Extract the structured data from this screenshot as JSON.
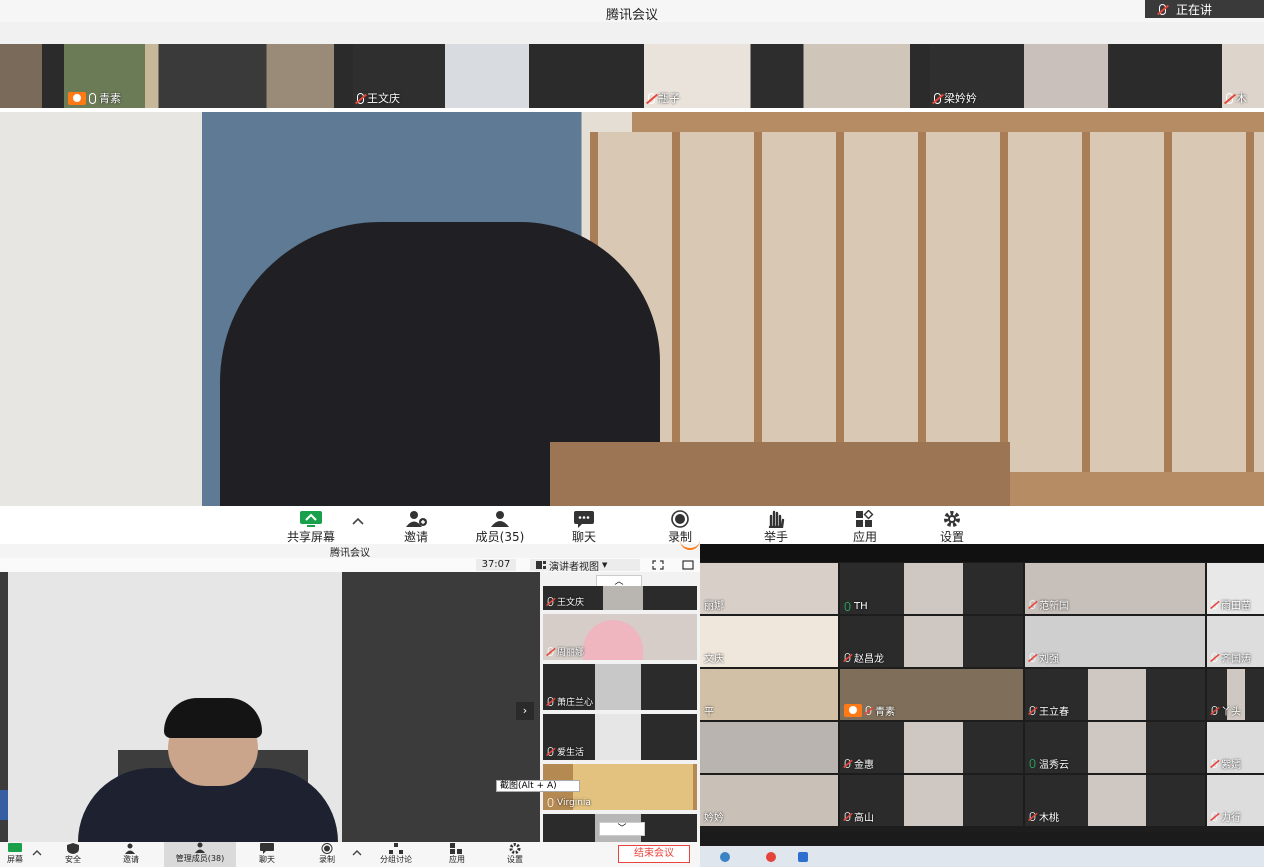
{
  "top": {
    "title": "腾讯会议",
    "speaking": "正在讲",
    "tiles": [
      {
        "name": "青素",
        "host": true
      },
      {
        "name": "王文庆"
      },
      {
        "name": "瓶子"
      },
      {
        "name": "梁妗妗"
      },
      {
        "name": "木"
      }
    ],
    "toolbar": [
      {
        "label": "共享屏幕"
      },
      {
        "label": "邀请"
      },
      {
        "label": "成员(35)"
      },
      {
        "label": "聊天"
      },
      {
        "label": "录制"
      },
      {
        "label": "举手"
      },
      {
        "label": "应用"
      },
      {
        "label": "设置"
      }
    ]
  },
  "left": {
    "title": "腾讯会议",
    "timer": "37:07",
    "view": "演讲者视图",
    "side_tiles": [
      "王文庆",
      "周丽娜",
      "萧庄兰心",
      "爱生活",
      "Virginia"
    ],
    "tooltip": "截图(Alt + A)",
    "toolbar": [
      {
        "label": "屏幕"
      },
      {
        "label": "安全"
      },
      {
        "label": "邀请"
      },
      {
        "label": "管理成员(38)"
      },
      {
        "label": "聊天"
      },
      {
        "label": "录制"
      },
      {
        "label": "分组讨论"
      },
      {
        "label": "应用"
      },
      {
        "label": "设置"
      }
    ],
    "end_button": "结束会议"
  },
  "right": {
    "grid": [
      [
        "丽娜",
        "TH",
        "范新国",
        "雨田苗"
      ],
      [
        "文庆",
        "赵昌龙",
        "刘强",
        "齐国涛"
      ],
      [
        "平",
        "青素",
        "王立春",
        "丫头"
      ],
      [
        "",
        "金惠",
        "温秀云",
        "紫嫣"
      ],
      [
        "妗妗",
        "高山",
        "木桃",
        "力行"
      ]
    ]
  },
  "colors": {
    "accent": "#ff7a14",
    "danger": "#e8453c",
    "green": "#25c26a",
    "dark": "#2b2b2b"
  }
}
